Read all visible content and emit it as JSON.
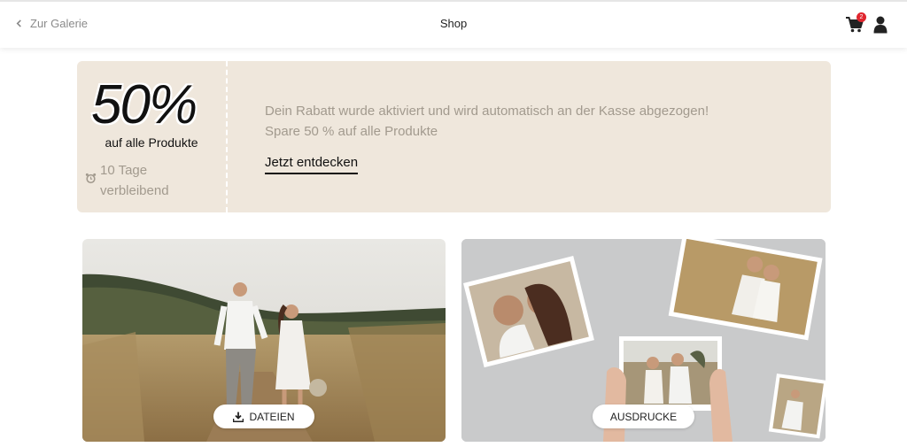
{
  "header": {
    "back_label": "Zur Galerie",
    "title": "Shop",
    "cart_count": "2"
  },
  "promo": {
    "percent": "50%",
    "subtitle": "auf alle Produkte",
    "remaining_line1": "10 Tage",
    "remaining_line2": "verbleibend",
    "message_line1": "Dein Rabatt wurde aktiviert und wird automatisch an der Kasse abgezogen!",
    "message_line2": "Spare 50 % auf alle Produkte",
    "cta_label": "Jetzt entdecken",
    "background_color": "#efe7dc"
  },
  "cards": {
    "files": {
      "label": "DATEIEN",
      "icon": "download-icon"
    },
    "prints": {
      "label": "AUSDRUCKE"
    }
  },
  "colors": {
    "badge": "#e0262e",
    "muted_text": "#a29a8e"
  }
}
